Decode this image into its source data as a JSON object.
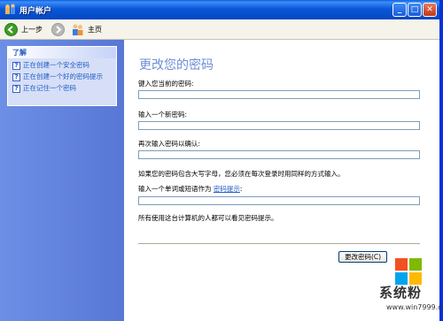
{
  "window": {
    "title": "用户帐户"
  },
  "titlebar": {
    "minimize": "_",
    "maximize": "□",
    "close": "✕"
  },
  "nav": {
    "back_label": "上一步",
    "home_label": "主页"
  },
  "sidebar": {
    "panel_title": "了解",
    "items": [
      {
        "label": "正在创建一个安全密码"
      },
      {
        "label": "正在创建一个好的密码提示"
      },
      {
        "label": "正在记住一个密码"
      }
    ]
  },
  "main": {
    "heading": "更改您的密码",
    "current_password_label": "键入您当前的密码:",
    "new_password_label": "输入一个新密码:",
    "confirm_password_label": "再次输入密码以确认:",
    "case_note": "如果您的密码包含大写字母，您必须在每次登录时用同样的方式输入。",
    "hint_label_prefix": "输入一个单词或短语作为",
    "hint_link": "密码提示",
    "hint_label_suffix": ":",
    "hint_visibility_note": "所有使用这台计算机的人都可以看见密码提示。",
    "change_button": "更改密码(C)"
  },
  "watermark": {
    "text": "系统粉",
    "url": "www.win7999.com"
  },
  "colors": {
    "titlebar": "#0a58d8",
    "sidebar": "#6d8fe5",
    "heading": "#6b8fd6",
    "link": "#215dc6"
  }
}
